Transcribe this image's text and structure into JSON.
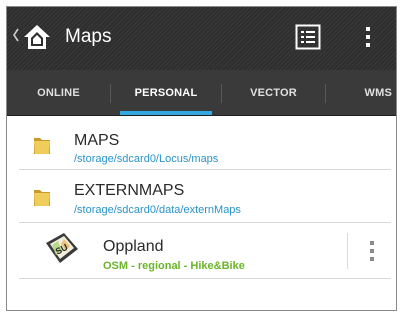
{
  "app": {
    "title": "Maps"
  },
  "tabs": [
    {
      "label": "ONLINE",
      "selected": false
    },
    {
      "label": "PERSONAL",
      "selected": true
    },
    {
      "label": "VECTOR",
      "selected": false
    },
    {
      "label": "WMS",
      "selected": false
    }
  ],
  "folders": [
    {
      "title": "MAPS",
      "path": "/storage/sdcard0/Locus/maps",
      "icon": "folder-icon"
    },
    {
      "title": "EXTERNMAPS",
      "path": "/storage/sdcard0/data/externMaps",
      "icon": "folder-icon"
    }
  ],
  "map_item": {
    "title": "Oppland",
    "subtitle": "OSM - regional - Hike&Bike",
    "icon": "map-pack-icon",
    "badge": "SU"
  },
  "colors": {
    "accent": "#33a8e0",
    "path_text": "#2a93c9",
    "subtitle_text": "#6bb42a",
    "folder": "#e6c24f"
  }
}
